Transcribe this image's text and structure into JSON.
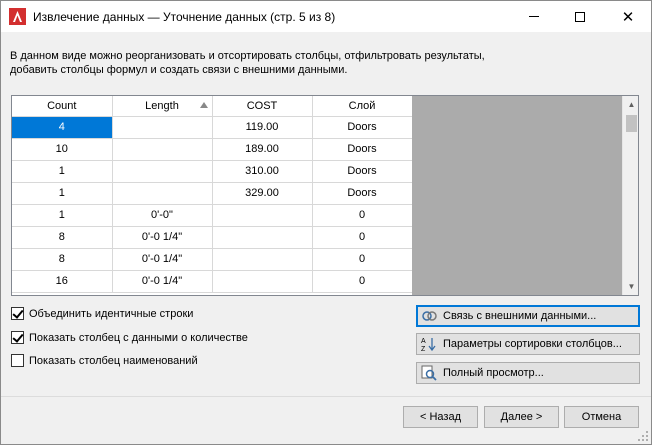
{
  "window": {
    "title": "Извлечение данных — Уточнение данных (стр. 5 из 8)"
  },
  "description": {
    "line1": "В данном виде можно реорганизовать и отсортировать столбцы, отфильтровать результаты,",
    "line2": "добавить столбцы формул и создать связи с внешними данными."
  },
  "grid": {
    "columns": [
      "Count",
      "Length",
      "COST",
      "Слой"
    ],
    "sorted_column": "Length",
    "rows": [
      [
        "4",
        "",
        "119.00",
        "Doors"
      ],
      [
        "10",
        "",
        "189.00",
        "Doors"
      ],
      [
        "1",
        "",
        "310.00",
        "Doors"
      ],
      [
        "1",
        "",
        "329.00",
        "Doors"
      ],
      [
        "1",
        "0'-0\"",
        "",
        "0"
      ],
      [
        "8",
        "0'-0 1/4\"",
        "",
        "0"
      ],
      [
        "8",
        "0'-0 1/4\"",
        "",
        "0"
      ],
      [
        "16",
        "0'-0 1/4\"",
        "",
        "0"
      ]
    ],
    "selected_cell": "row 1, column Count"
  },
  "options": {
    "combine_identical": {
      "label": "Объединить идентичные строки",
      "checked": true
    },
    "show_count_column": {
      "label": "Показать столбец с данными о количестве",
      "checked": true
    },
    "show_name_column": {
      "label": "Показать столбец наименований",
      "checked": false
    }
  },
  "side_buttons": {
    "link_external": "Связь с внешними данными...",
    "sort_params": "Параметры сортировки столбцов...",
    "full_preview": "Полный просмотр..."
  },
  "nav": {
    "back": "< Назад",
    "next": "Далее >",
    "cancel": "Отмена"
  },
  "colors": {
    "selection": "#0078d7",
    "app_icon_red": "#d32f2f"
  }
}
